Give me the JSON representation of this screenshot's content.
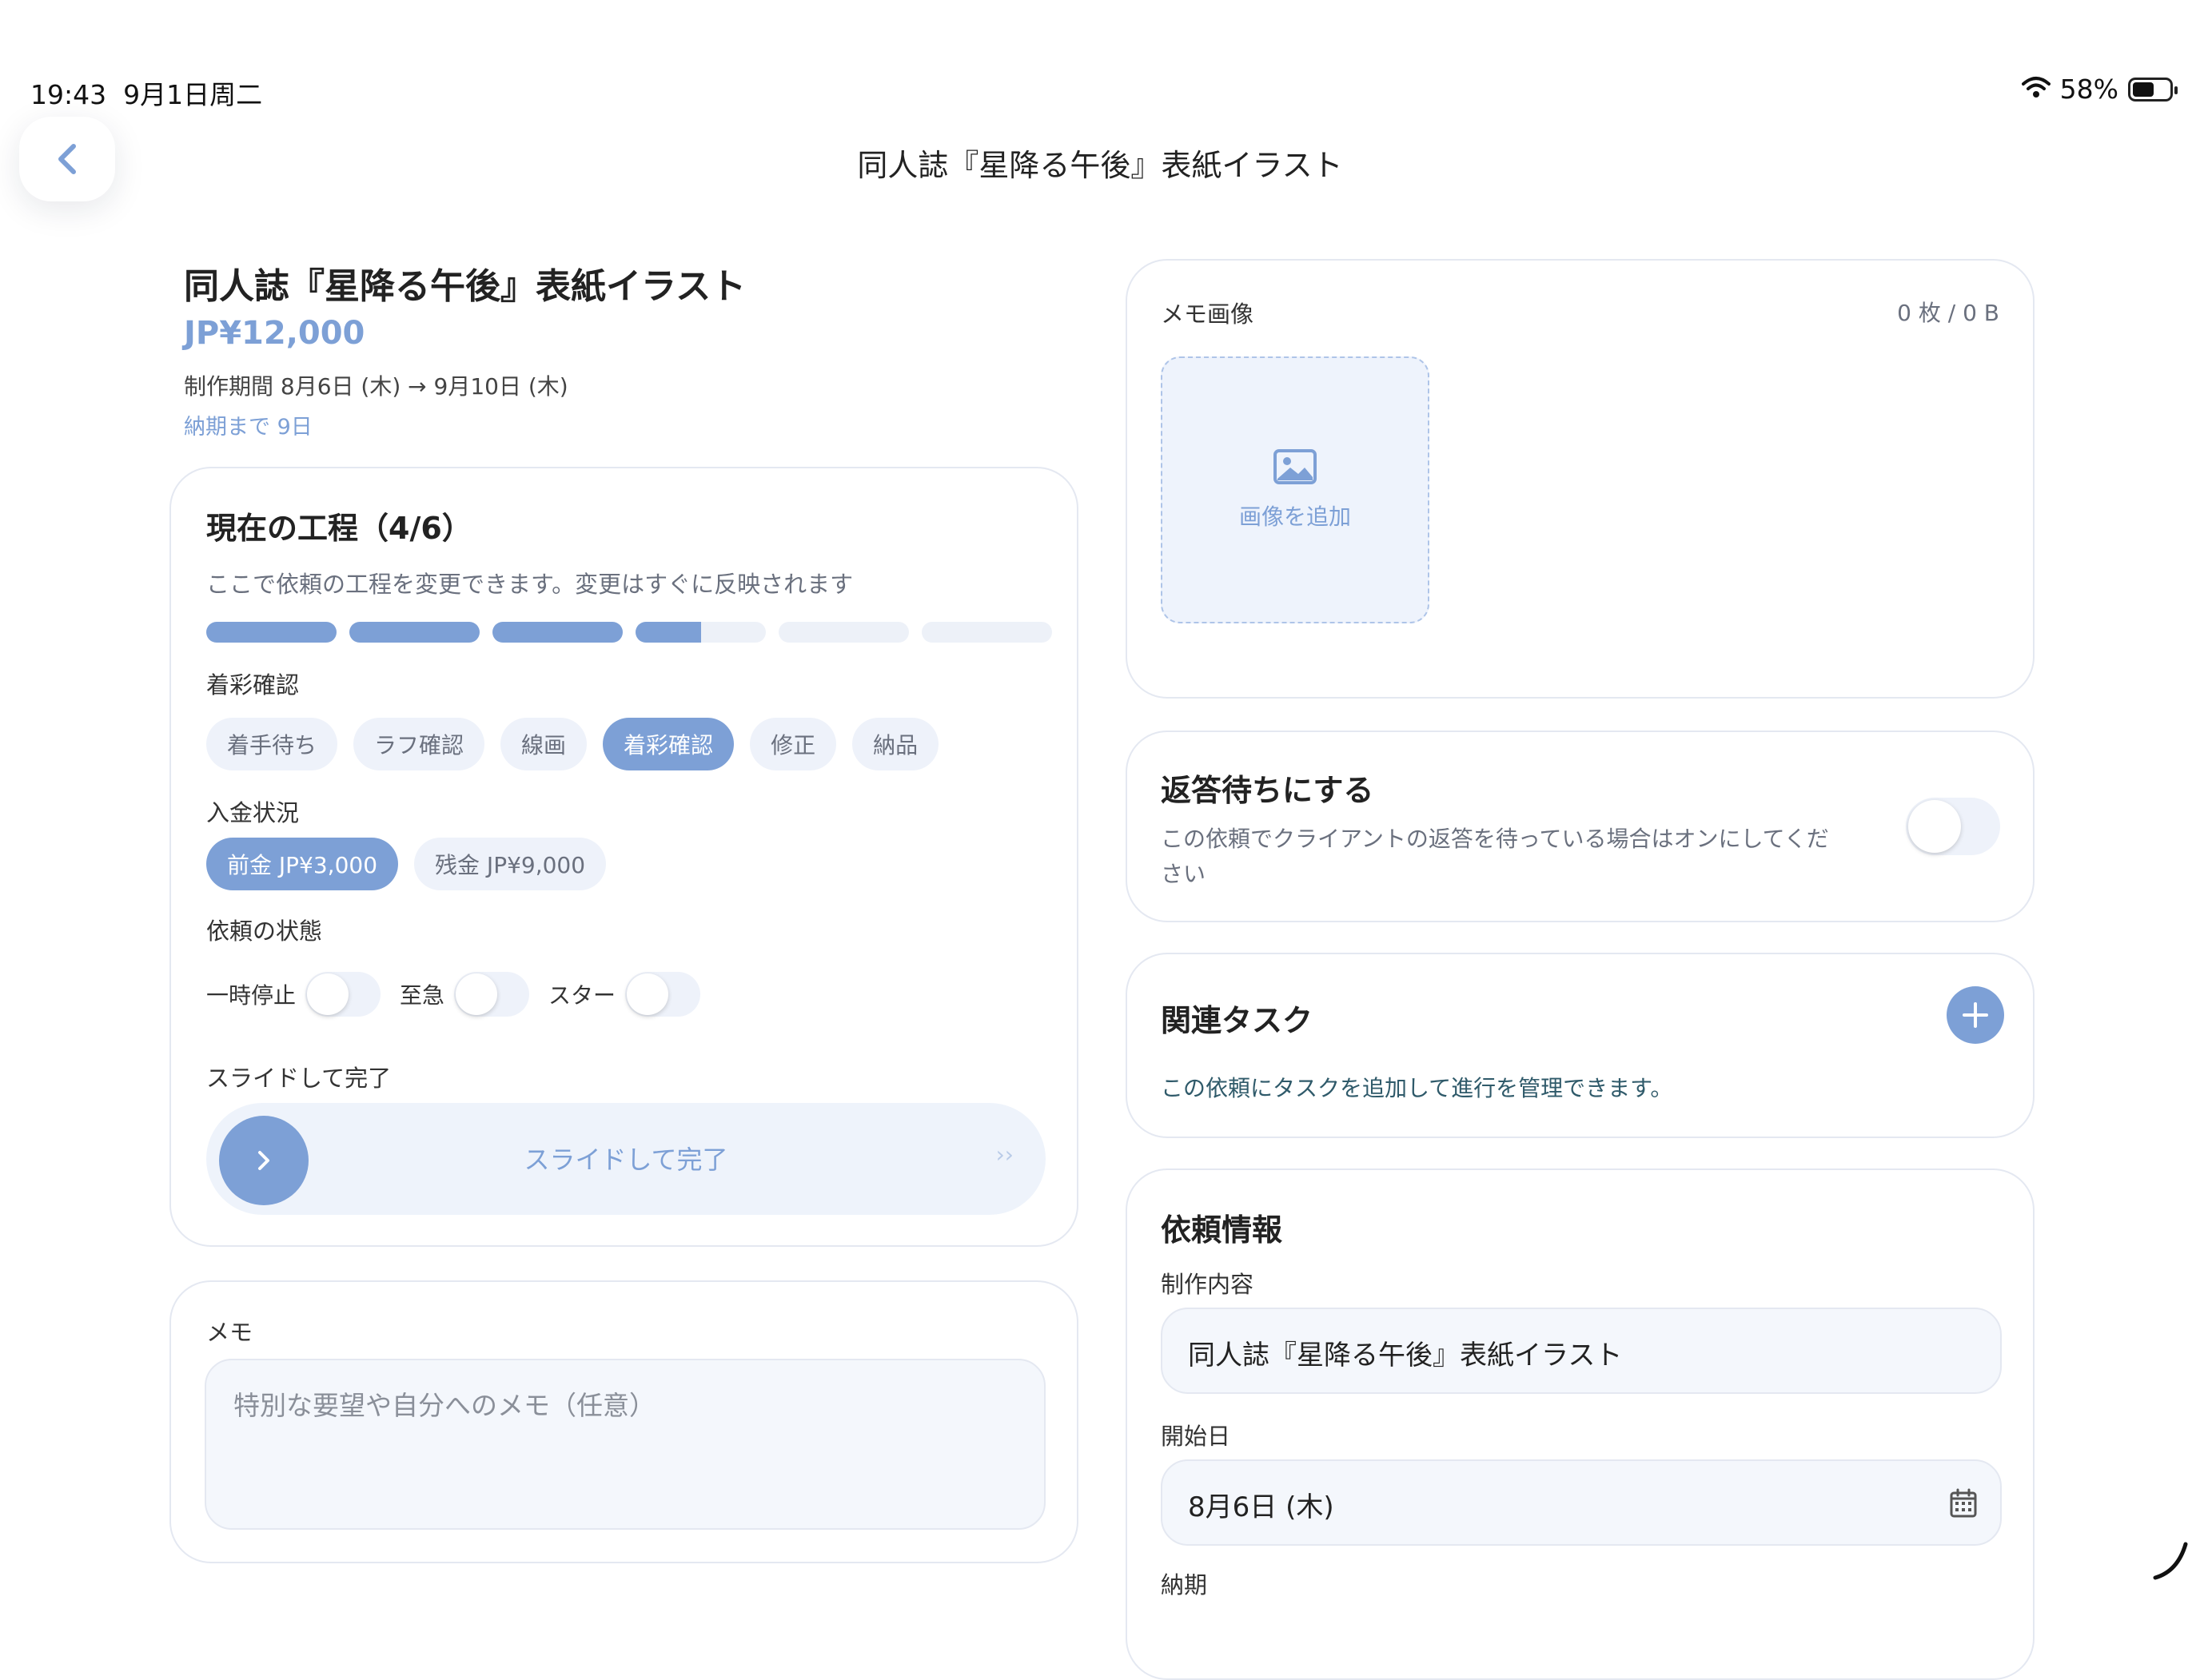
{
  "status_bar": {
    "time": "19:43",
    "date": "9月1日周二",
    "battery": "58%",
    "battery_level": 0.58
  },
  "nav": {
    "title": "同人誌『星降る午後』表紙イラスト"
  },
  "header": {
    "title": "同人誌『星降る午後』表紙イラスト",
    "price": "JP¥12,000",
    "period": "制作期間 8月6日 (木) → 9月10日 (木)",
    "deadline_note": "納期まで 9日"
  },
  "progress": {
    "title": "現在の工程（4/6）",
    "description": "ここで依頼の工程を変更できます。変更はすぐに反映されます",
    "segments": [
      1,
      1,
      1,
      0.5,
      0,
      0
    ],
    "current_stage": "着彩確認",
    "stages": [
      "着手待ち",
      "ラフ確認",
      "線画",
      "着彩確認",
      "修正",
      "納品"
    ],
    "active_stage_index": 3,
    "payment_label": "入金状況",
    "payments": [
      "前金 JP¥3,000",
      "残金 JP¥9,000"
    ],
    "active_payment_index": 0,
    "status_label": "依頼の状態",
    "toggles": [
      "一時停止",
      "至急",
      "スター"
    ],
    "slide_label": "スライドして完了",
    "slide_text": "スライドして完了",
    "slide_arrows": "››"
  },
  "memo": {
    "label": "メモ",
    "placeholder": "特別な要望や自分へのメモ（任意）"
  },
  "image_memo": {
    "label": "メモ画像",
    "count": "0 枚 / 0 B",
    "add_label": "画像を追加"
  },
  "reply": {
    "title": "返答待ちにする",
    "description_line1": "この依頼でクライアントの返答を待っている場合はオンにしてくだ",
    "description_line2": "さい"
  },
  "tasks": {
    "title": "関連タスク",
    "description": "この依頼にタスクを追加して進行を管理できます。"
  },
  "info": {
    "title": "依頼情報",
    "content_label": "制作内容",
    "content_value": "同人誌『星降る午後』表紙イラスト",
    "start_label": "開始日",
    "start_value": "8月6日 (木)",
    "due_label": "納期"
  },
  "colors": {
    "accent": "#7da0d6",
    "card_border": "#e4e8f1",
    "chip_bg": "#eef2fa"
  }
}
